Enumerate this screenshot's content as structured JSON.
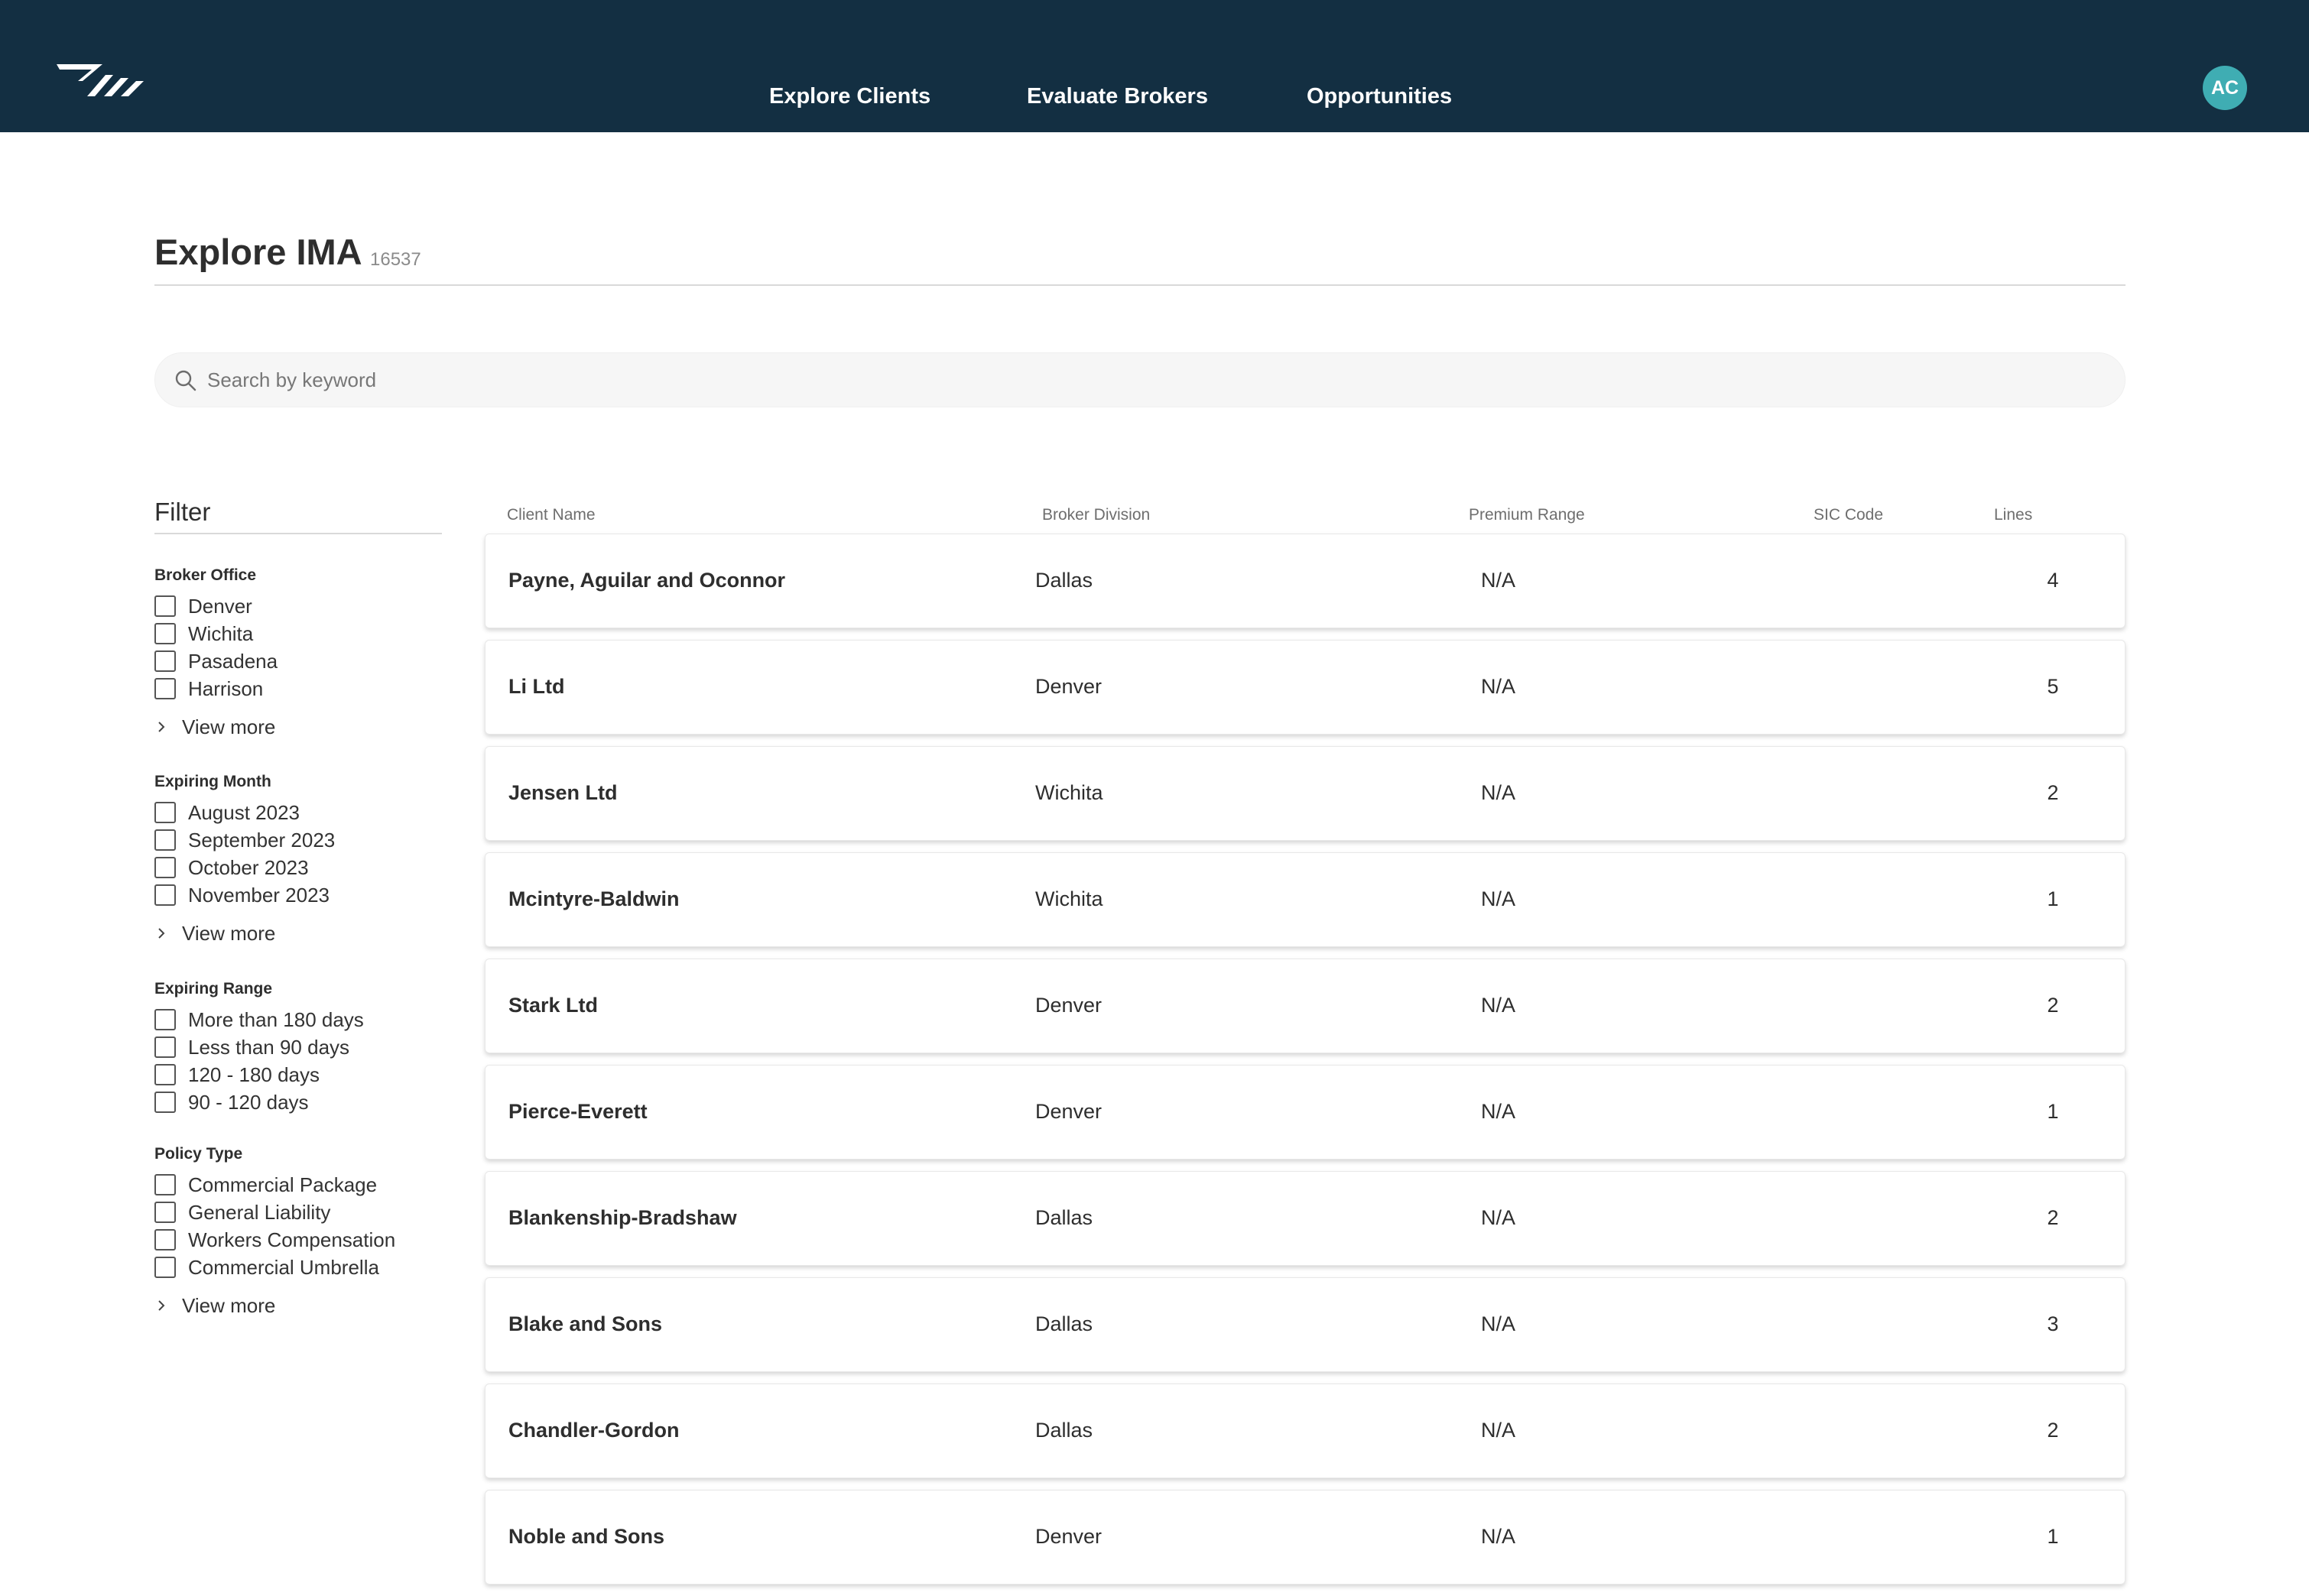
{
  "nav": {
    "items": [
      "Explore Clients",
      "Evaluate Brokers",
      "Opportunities"
    ],
    "avatar_initials": "AC",
    "colors": {
      "bar": "#132f42",
      "avatar": "#3fadb3"
    }
  },
  "page": {
    "title": "Explore IMA",
    "count": "16537"
  },
  "search": {
    "placeholder": "Search by keyword",
    "value": ""
  },
  "filter": {
    "title": "Filter",
    "view_more_label": "View more",
    "groups": [
      {
        "title": "Broker Office",
        "options": [
          "Denver",
          "Wichita",
          "Pasadena",
          "Harrison"
        ],
        "has_view_more": true
      },
      {
        "title": "Expiring Month",
        "options": [
          "August 2023",
          "September 2023",
          "October 2023",
          "November 2023"
        ],
        "has_view_more": true
      },
      {
        "title": "Expiring Range",
        "options": [
          "More than 180 days",
          "Less than 90 days",
          "120 - 180 days",
          "90 - 120 days"
        ],
        "has_view_more": false
      },
      {
        "title": "Policy Type",
        "options": [
          "Commercial Package",
          "General Liability",
          "Workers Compensation",
          "Commercial Umbrella"
        ],
        "has_view_more": true
      }
    ]
  },
  "table": {
    "headers": {
      "client_name": "Client Name",
      "broker_division": "Broker Division",
      "premium_range": "Premium Range",
      "sic_code": "SIC Code",
      "lines": "Lines"
    },
    "rows": [
      {
        "client_name": "Payne, Aguilar and Oconnor",
        "broker_division": "Dallas",
        "premium_range": "N/A",
        "sic_code": "",
        "lines": "4"
      },
      {
        "client_name": "Li Ltd",
        "broker_division": "Denver",
        "premium_range": "N/A",
        "sic_code": "",
        "lines": "5"
      },
      {
        "client_name": "Jensen Ltd",
        "broker_division": "Wichita",
        "premium_range": "N/A",
        "sic_code": "",
        "lines": "2"
      },
      {
        "client_name": "Mcintyre-Baldwin",
        "broker_division": "Wichita",
        "premium_range": "N/A",
        "sic_code": "",
        "lines": "1"
      },
      {
        "client_name": "Stark Ltd",
        "broker_division": "Denver",
        "premium_range": "N/A",
        "sic_code": "",
        "lines": "2"
      },
      {
        "client_name": "Pierce-Everett",
        "broker_division": "Denver",
        "premium_range": "N/A",
        "sic_code": "",
        "lines": "1"
      },
      {
        "client_name": "Blankenship-Bradshaw",
        "broker_division": "Dallas",
        "premium_range": "N/A",
        "sic_code": "",
        "lines": "2"
      },
      {
        "client_name": "Blake and Sons",
        "broker_division": "Dallas",
        "premium_range": "N/A",
        "sic_code": "",
        "lines": "3"
      },
      {
        "client_name": "Chandler-Gordon",
        "broker_division": "Dallas",
        "premium_range": "N/A",
        "sic_code": "",
        "lines": "2"
      },
      {
        "client_name": "Noble and Sons",
        "broker_division": "Denver",
        "premium_range": "N/A",
        "sic_code": "",
        "lines": "1"
      }
    ]
  }
}
